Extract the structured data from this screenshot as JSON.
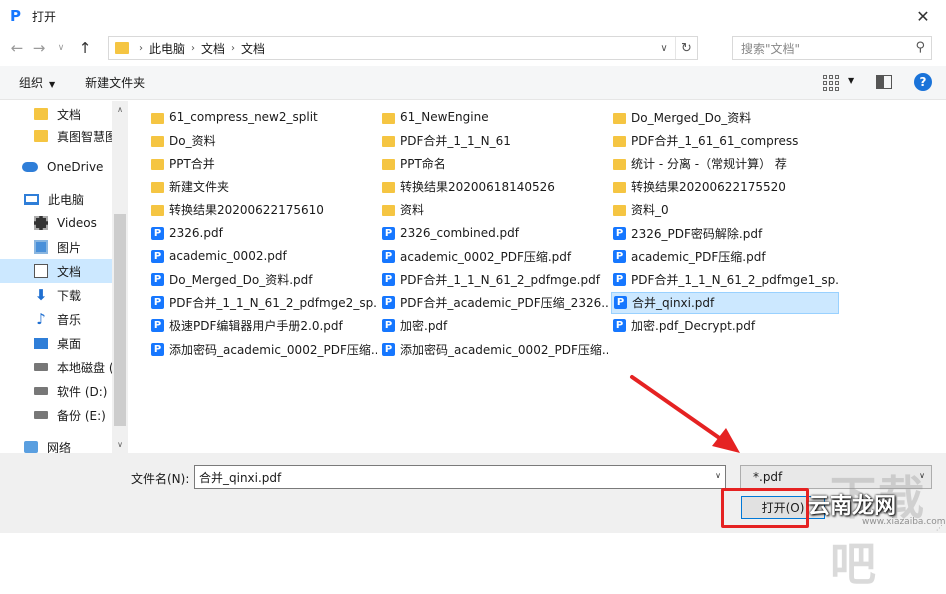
{
  "window": {
    "title": "打开",
    "app_icon": "P",
    "close_glyph": "✕"
  },
  "address": {
    "crumbs": [
      "此电脑",
      "文档",
      "文档"
    ],
    "search_placeholder": "搜索\"文档\""
  },
  "toolbar": {
    "organize": "组织",
    "new_folder": "新建文件夹",
    "help": "?"
  },
  "sidebar": {
    "items": [
      {
        "label": "文档",
        "icon": "folder-icon"
      },
      {
        "label": "真图智慧图",
        "icon": "folder-icon"
      },
      {
        "label": "OneDrive",
        "icon": "onedrive-icon"
      },
      {
        "label": "此电脑",
        "icon": "computer-icon"
      },
      {
        "label": "Videos",
        "icon": "videos-icon"
      },
      {
        "label": "图片",
        "icon": "pictures-icon"
      },
      {
        "label": "文档",
        "icon": "documents-icon",
        "selected": true
      },
      {
        "label": "下载",
        "icon": "download-icon"
      },
      {
        "label": "音乐",
        "icon": "music-icon"
      },
      {
        "label": "桌面",
        "icon": "desktop-icon"
      },
      {
        "label": "本地磁盘 (",
        "icon": "drive-icon"
      },
      {
        "label": "软件 (D:)",
        "icon": "drive-icon"
      },
      {
        "label": "备份 (E:)",
        "icon": "drive-icon"
      },
      {
        "label": "网络",
        "icon": "network-icon"
      }
    ]
  },
  "files": {
    "col1": [
      {
        "name": "61_compress_new2_split",
        "type": "folder"
      },
      {
        "name": "Do_资料",
        "type": "folder"
      },
      {
        "name": "PPT合并",
        "type": "folder"
      },
      {
        "name": "新建文件夹",
        "type": "folder"
      },
      {
        "name": "转换结果20200622175610",
        "type": "folder"
      },
      {
        "name": "2326.pdf",
        "type": "pdf"
      },
      {
        "name": "academic_0002.pdf",
        "type": "pdf"
      },
      {
        "name": "Do_Merged_Do_资料.pdf",
        "type": "pdf"
      },
      {
        "name": "PDF合并_1_1_N_61_2_pdfmge2_sp...",
        "type": "pdf"
      },
      {
        "name": "极速PDF编辑器用户手册2.0.pdf",
        "type": "pdf"
      },
      {
        "name": "添加密码_academic_0002_PDF压缩...",
        "type": "pdf"
      }
    ],
    "col2": [
      {
        "name": "61_NewEngine",
        "type": "folder"
      },
      {
        "name": "PDF合并_1_1_N_61",
        "type": "folder"
      },
      {
        "name": "PPT命名",
        "type": "folder"
      },
      {
        "name": "转换结果20200618140526",
        "type": "folder"
      },
      {
        "name": "资料",
        "type": "folder"
      },
      {
        "name": "2326_combined.pdf",
        "type": "pdf"
      },
      {
        "name": "academic_0002_PDF压缩.pdf",
        "type": "pdf"
      },
      {
        "name": "PDF合并_1_1_N_61_2_pdfmge.pdf",
        "type": "pdf"
      },
      {
        "name": "PDF合并_academic_PDF压缩_2326...",
        "type": "pdf"
      },
      {
        "name": "加密.pdf",
        "type": "pdf"
      },
      {
        "name": "添加密码_academic_0002_PDF压缩...",
        "type": "pdf"
      }
    ],
    "col3": [
      {
        "name": "Do_Merged_Do_资料",
        "type": "folder"
      },
      {
        "name": "PDF合并_1_61_61_compress",
        "type": "folder"
      },
      {
        "name": "统计 - 分离 -（常规计算） 荐",
        "type": "folder"
      },
      {
        "name": "转换结果20200622175520",
        "type": "folder"
      },
      {
        "name": "资料_0",
        "type": "folder"
      },
      {
        "name": "2326_PDF密码解除.pdf",
        "type": "pdf"
      },
      {
        "name": "academic_PDF压缩.pdf",
        "type": "pdf"
      },
      {
        "name": "PDF合并_1_1_N_61_2_pdfmge1_sp...",
        "type": "pdf"
      },
      {
        "name": "合并_qinxi.pdf",
        "type": "pdf",
        "selected": true
      },
      {
        "name": "加密.pdf_Decrypt.pdf",
        "type": "pdf"
      }
    ]
  },
  "bottom": {
    "filename_label": "文件名(N):",
    "filename_value": "合并_qinxi.pdf",
    "filetype_value": "*.pdf",
    "open_button": "打开(O)"
  },
  "watermark": {
    "main": "云南龙网",
    "sub": "www.xiazaiba.com",
    "bg": "下载吧"
  },
  "colors": {
    "accent": "#1677ff",
    "selection": "#cce8ff",
    "annotation_red": "#e52222",
    "folder": "#f5c542"
  }
}
